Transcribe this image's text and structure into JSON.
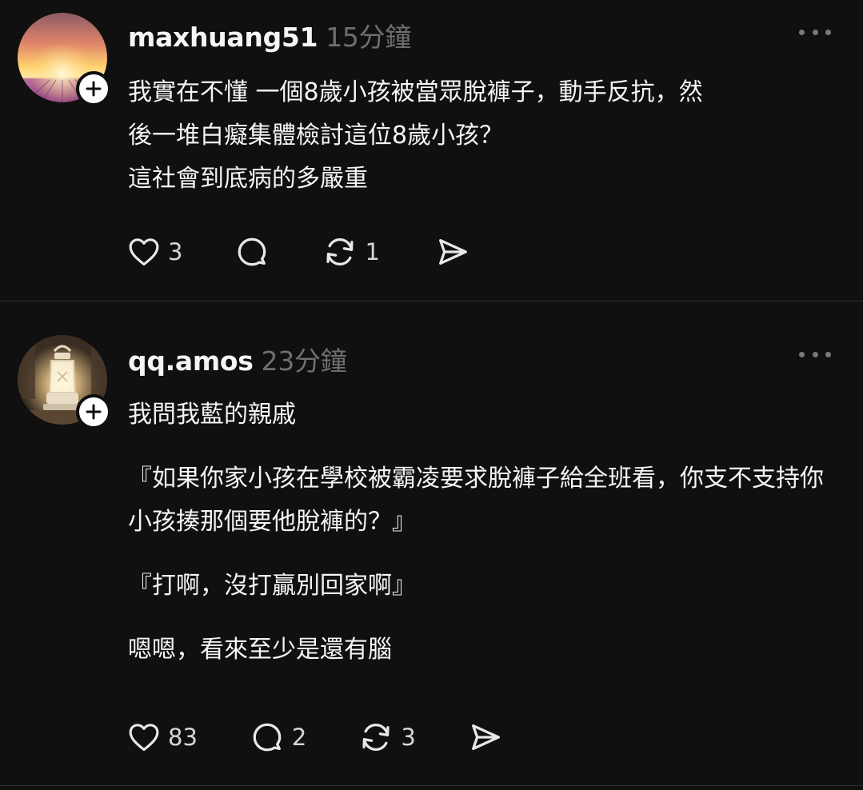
{
  "posts": [
    {
      "username": "maxhuang51",
      "timestamp": "15分鐘",
      "lines": [
        "我實在不懂 一個8歲小孩被當眾脫褲子，動手反抗，然",
        "後一堆白癡集體檢討這位8歲小孩？",
        "這社會到底病的多嚴重"
      ],
      "likes": "3",
      "replies": "",
      "reposts": "1",
      "avatar_icon": "sunset-lavender-field-avatar"
    },
    {
      "username": "qq.amos",
      "timestamp": "23分鐘",
      "paragraphs": [
        "我問我藍的親戚",
        "『如果你家小孩在學校被霸凌要求脫褲子給全班看，你支不支持你小孩揍那個要他脫褲的？』",
        "『打啊，沒打贏別回家啊』",
        "嗯嗯，看來至少是還有腦"
      ],
      "likes": "83",
      "replies": "2",
      "reposts": "3",
      "avatar_icon": "lantern-avatar"
    }
  ],
  "colors": {
    "background": "#101010",
    "text": "#f3f5f7",
    "muted": "#6f6f6f",
    "divider": "#2e2e2e"
  }
}
